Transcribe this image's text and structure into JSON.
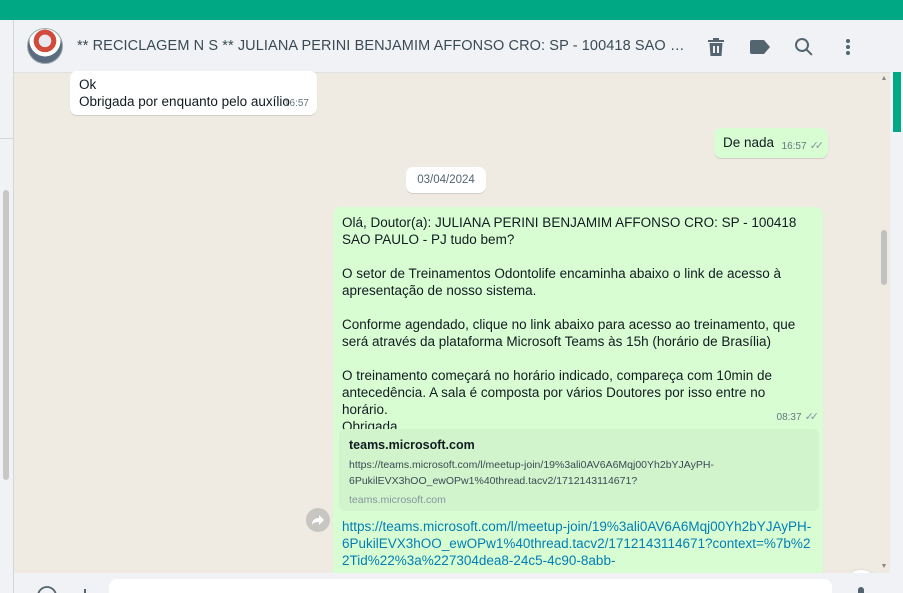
{
  "header": {
    "title": "** RECICLAGEM   N S ** JULIANA PERINI BENJAMIM AFFONSO CRO: SP - 100418  SAO PAULO - PJ",
    "icons": [
      "delete-icon",
      "label-icon",
      "search-icon",
      "menu-icon"
    ]
  },
  "messages": {
    "m1": {
      "line1": "Ok",
      "line2": "Obrigada por enquanto pelo auxílio",
      "time": "16:57"
    },
    "m2": {
      "text": "De nada",
      "time": "16:57"
    },
    "date_separator": "03/04/2024",
    "m3": {
      "p1": "Olá, Doutor(a): JULIANA PERINI BENJAMIM AFFONSO CRO: SP - 100418  SAO PAULO - PJ tudo bem?",
      "p2": "O setor de Treinamentos Odontolife encaminha abaixo o link de acesso à apresentação de nosso sistema.",
      "p3": "Conforme agendado, clique no link abaixo para acesso ao treinamento, que será através da plataforma Microsoft Teams às 15h (horário de Brasília)",
      "p4": "O treinamento começará no horário indicado, compareça com 10min de antecedência. A sala é composta por vários Doutores por isso entre no horário.",
      "p5": "Obrigada",
      "time": "08:37"
    },
    "m4": {
      "preview_title": "teams.microsoft.com",
      "preview_url": "https://teams.microsoft.com/l/meetup-join/19%3ali0AV6A6Mqj00Yh2bYJAyPH-6PukilEVX3hOO_ewOPw1%40thread.tacv2/1712143114671?",
      "preview_domain": "teams.microsoft.com",
      "link": "https://teams.microsoft.com/l/meetup-join/19%3ali0AV6A6Mqj00Yh2bYJAyPH-6PukilEVX3hOO_ewOPw1%40thread.tacv2/1712143114671?context=%7b%22Tid%22%3a%227304dea8-24c5-4c90-8abb-"
    }
  },
  "colors": {
    "accent": "#00a884",
    "outgoing_bubble": "#d9fdd3",
    "incoming_bubble": "#ffffff",
    "link": "#027eb5"
  }
}
